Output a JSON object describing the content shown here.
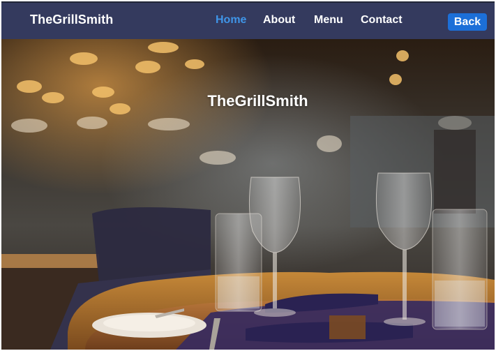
{
  "navbar": {
    "brand": "TheGrillSmith",
    "links": [
      {
        "label": "Home",
        "active": true
      },
      {
        "label": "About",
        "active": false
      },
      {
        "label": "Menu",
        "active": false
      },
      {
        "label": "Contact",
        "active": false
      }
    ],
    "back_label": "Back"
  },
  "hero": {
    "title": "TheGrillSmith",
    "image": "restaurant-interior-photo"
  },
  "colors": {
    "navbar_bg": "#343a5e",
    "active_link": "#3f95e8",
    "back_button": "#1c6fd8"
  }
}
